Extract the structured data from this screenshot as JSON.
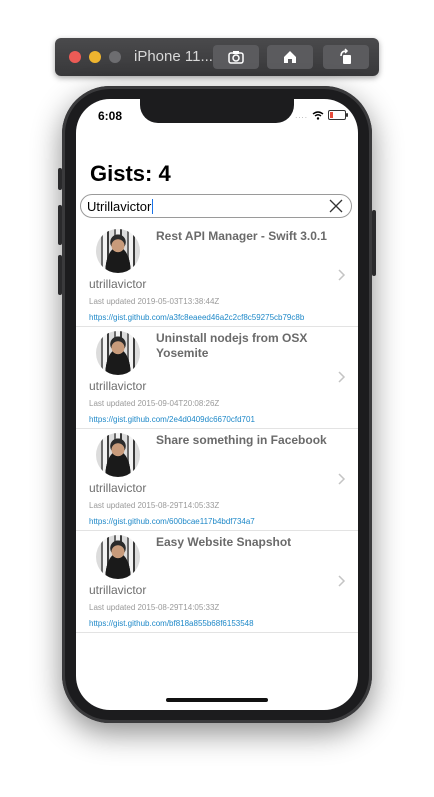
{
  "simulator": {
    "title": "iPhone 11...",
    "icons": [
      "screenshot-icon",
      "home-icon",
      "rotate-icon"
    ]
  },
  "status_bar": {
    "time": "6:08",
    "signal": "....",
    "icons": [
      "wifi-icon",
      "battery-icon"
    ]
  },
  "header": {
    "title": "Gists: 4"
  },
  "search": {
    "value": "Utrillavictor",
    "placeholder": ""
  },
  "gists": [
    {
      "title": "Rest API Manager - Swift 3.0.1",
      "owner": "utrillavictor",
      "updated": "Last updated 2019-05-03T13:38:44Z",
      "url": "https://gist.github.com/a3fc8eaeed46a2c2cf8c59275cb79c8b"
    },
    {
      "title": "Uninstall nodejs from OSX Yosemite",
      "owner": "utrillavictor",
      "updated": "Last updated 2015-09-04T20:08:26Z",
      "url": "https://gist.github.com/2e4d0409dc6670cfd701"
    },
    {
      "title": "Share something in Facebook",
      "owner": "utrillavictor",
      "updated": "Last updated 2015-08-29T14:05:33Z",
      "url": "https://gist.github.com/600bcae117b4bdf734a7"
    },
    {
      "title": "Easy Website Snapshot",
      "owner": "utrillavictor",
      "updated": "Last updated 2015-08-29T14:05:33Z",
      "url": "https://gist.github.com/bf818a855b68f6153548"
    }
  ],
  "colors": {
    "link": "#1e88c8",
    "secondary_text": "#6e6e6e",
    "battery_low": "#e74c3c"
  }
}
